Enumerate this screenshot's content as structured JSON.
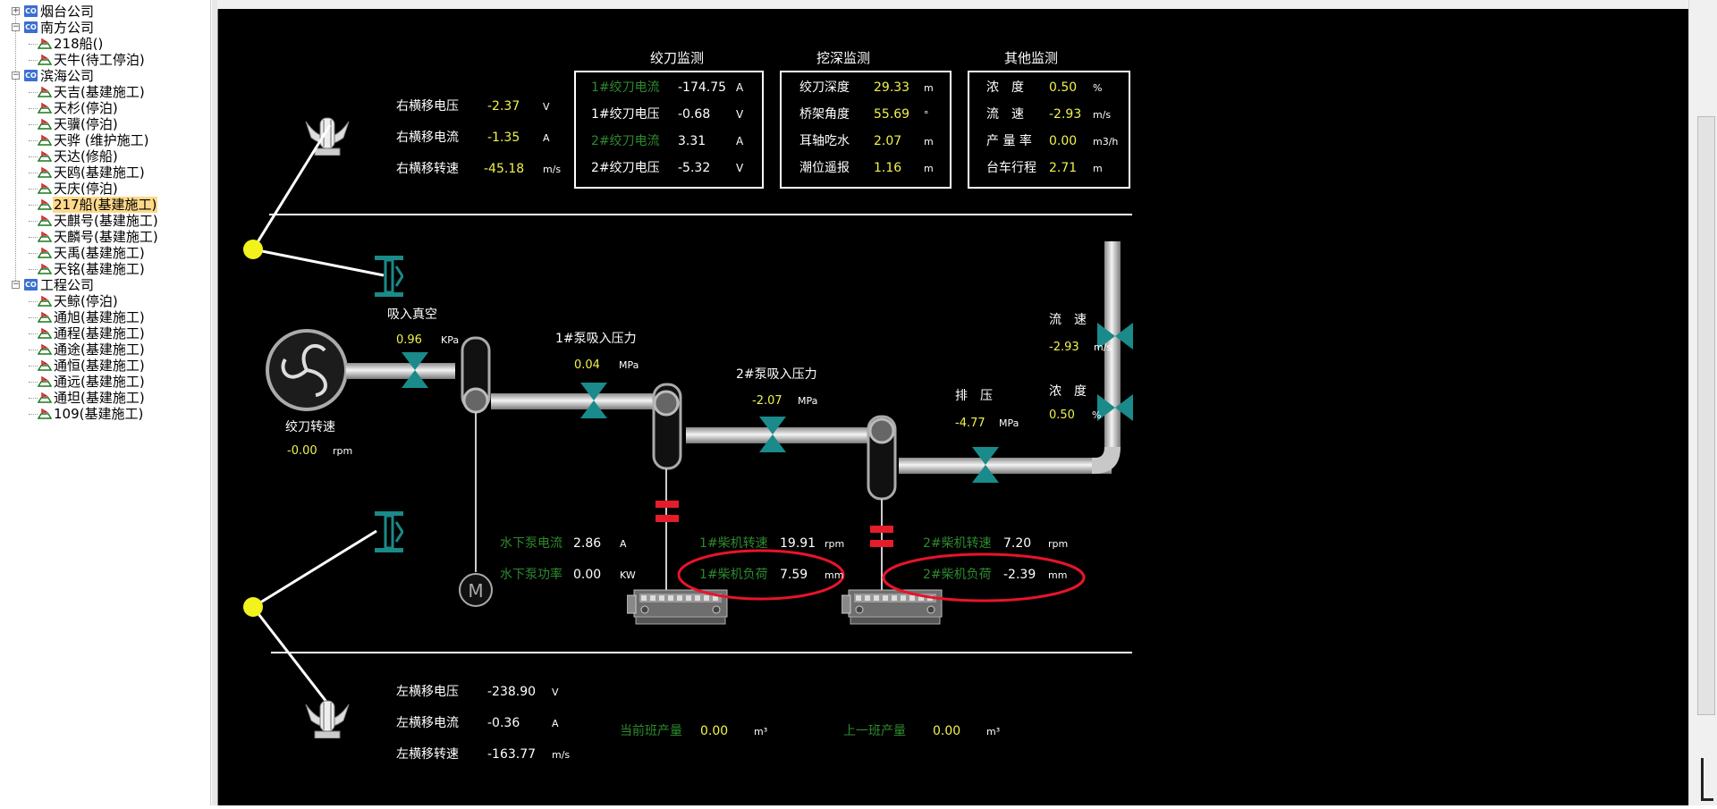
{
  "tree": [
    {
      "label": "烟台公司",
      "type": "company",
      "level": 0,
      "expander": "+"
    },
    {
      "label": "南方公司",
      "type": "company",
      "level": 0,
      "expander": "−"
    },
    {
      "label": "218船()",
      "type": "ship",
      "level": 1
    },
    {
      "label": "天牛(待工停泊)",
      "type": "ship",
      "level": 1
    },
    {
      "label": "滨海公司",
      "type": "company",
      "level": 0,
      "expander": "−"
    },
    {
      "label": "天吉(基建施工)",
      "type": "ship",
      "level": 1
    },
    {
      "label": "天杉(停泊)",
      "type": "ship",
      "level": 1
    },
    {
      "label": "天骥(停泊)",
      "type": "ship",
      "level": 1
    },
    {
      "label": "天骅 (维护施工)",
      "type": "ship",
      "level": 1
    },
    {
      "label": "天达(修船)",
      "type": "ship",
      "level": 1
    },
    {
      "label": "天鸥(基建施工)",
      "type": "ship",
      "level": 1
    },
    {
      "label": "天庆(停泊)",
      "type": "ship",
      "level": 1
    },
    {
      "label": "217船(基建施工)",
      "type": "ship",
      "level": 1,
      "selected": true
    },
    {
      "label": "天麒号(基建施工)",
      "type": "ship",
      "level": 1
    },
    {
      "label": "天麟号(基建施工)",
      "type": "ship",
      "level": 1
    },
    {
      "label": "天禹(基建施工)",
      "type": "ship",
      "level": 1
    },
    {
      "label": "天铭(基建施工)",
      "type": "ship",
      "level": 1
    },
    {
      "label": "工程公司",
      "type": "company",
      "level": 0,
      "expander": "−"
    },
    {
      "label": "天鲸(停泊)",
      "type": "ship",
      "level": 1
    },
    {
      "label": "通旭(基建施工)",
      "type": "ship",
      "level": 1
    },
    {
      "label": "通程(基建施工)",
      "type": "ship",
      "level": 1
    },
    {
      "label": "通途(基建施工)",
      "type": "ship",
      "level": 1
    },
    {
      "label": "通恒(基建施工)",
      "type": "ship",
      "level": 1
    },
    {
      "label": "通远(基建施工)",
      "type": "ship",
      "level": 1
    },
    {
      "label": "通坦(基建施工)",
      "type": "ship",
      "level": 1
    },
    {
      "label": "109(基建施工)",
      "type": "ship",
      "level": 1
    }
  ],
  "icons": {
    "company": "company-co-icon",
    "ship": "ship-status-icon",
    "valve": "valve-icon",
    "motor": "motor-m-icon",
    "engine": "diesel-engine-icon",
    "anchor": "anchor-winch-icon",
    "cutter": "cutter-head-icon",
    "pulley": "i-beam-pulley-icon"
  },
  "colors": {
    "value": "#f1f24a",
    "label": "#ffffff",
    "green_label": "#2e8a2e",
    "pipe": "#d0d0d0",
    "valve": "#1a8a8a",
    "highlight": "#e8142a",
    "background": "#000000"
  },
  "right_traverse": {
    "rows": [
      {
        "label": "右横移电压",
        "value": "-2.37",
        "unit": "V"
      },
      {
        "label": "右横移电流",
        "value": "-1.35",
        "unit": "A"
      },
      {
        "label": "右横移转速",
        "value": "-45.18",
        "unit": "m/s"
      }
    ]
  },
  "cutter_monitor": {
    "title": "绞刀监测",
    "rows": [
      {
        "label": "1#绞刀电流",
        "value": "-174.75",
        "unit": "A",
        "label_green": true
      },
      {
        "label": "1#绞刀电压",
        "value": "-0.68",
        "unit": "V",
        "label_green": false
      },
      {
        "label": "2#绞刀电流",
        "value": "3.31",
        "unit": "A",
        "label_green": true
      },
      {
        "label": "2#绞刀电压",
        "value": "-5.32",
        "unit": "V",
        "label_green": false
      }
    ]
  },
  "dredge_monitor": {
    "title": "挖深监测",
    "rows": [
      {
        "label": "绞刀深度",
        "value": "29.33",
        "unit": "m"
      },
      {
        "label": "桥架角度",
        "value": "55.69",
        "unit": "°"
      },
      {
        "label": "耳轴吃水",
        "value": "2.07",
        "unit": "m"
      },
      {
        "label": "潮位遥报",
        "value": "1.16",
        "unit": "m"
      }
    ]
  },
  "other_monitor": {
    "title": "其他监测",
    "rows": [
      {
        "label": "浓　度",
        "value": "0.50",
        "unit": "%"
      },
      {
        "label": "流　速",
        "value": "-2.93",
        "unit": "m/s"
      },
      {
        "label": "产 量 率",
        "value": "0.00",
        "unit": "m3/h"
      },
      {
        "label": "台车行程",
        "value": "2.71",
        "unit": "m"
      }
    ]
  },
  "suction_vacuum": {
    "label": "吸入真空",
    "value": "0.96",
    "unit": "KPa"
  },
  "pump1_suction": {
    "label": "1#泵吸入压力",
    "value": "0.04",
    "unit": "MPa"
  },
  "pump2_suction": {
    "label": "2#泵吸入压力",
    "value": "-2.07",
    "unit": "MPa"
  },
  "discharge": {
    "label": "排　压",
    "value": "-4.77",
    "unit": "MPa"
  },
  "flow_speed": {
    "label": "流　速",
    "value": "-2.93",
    "unit": "m/s"
  },
  "density": {
    "label": "浓　度",
    "value": "0.50",
    "unit": "%"
  },
  "cutter_speed": {
    "label": "绞刀转速",
    "value": "-0.00",
    "unit": "rpm"
  },
  "underwater_pump": {
    "current": {
      "label": "水下泵电流",
      "value": "2.86",
      "unit": "A"
    },
    "power": {
      "label": "水下泵功率",
      "value": "0.00",
      "unit": "KW"
    },
    "motor_label": "M"
  },
  "engine1": {
    "speed": {
      "label": "1#柴机转速",
      "value": "19.91",
      "unit": "rpm"
    },
    "load": {
      "label": "1#柴机负荷",
      "value": "7.59",
      "unit": "mm"
    }
  },
  "engine2": {
    "speed": {
      "label": "2#柴机转速",
      "value": "7.20",
      "unit": "rpm"
    },
    "load": {
      "label": "2#柴机负荷",
      "value": "-2.39",
      "unit": "mm"
    }
  },
  "left_traverse": {
    "rows": [
      {
        "label": "左横移电压",
        "value": "-238.90",
        "unit": "V"
      },
      {
        "label": "左横移电流",
        "value": "-0.36",
        "unit": "A"
      },
      {
        "label": "左横移转速",
        "value": "-163.77",
        "unit": "m/s"
      }
    ]
  },
  "production": {
    "current_shift": {
      "label": "当前班产量",
      "value": "0.00",
      "unit": "m³"
    },
    "last_shift": {
      "label": "上一班产量",
      "value": "0.00",
      "unit": "m³"
    }
  }
}
